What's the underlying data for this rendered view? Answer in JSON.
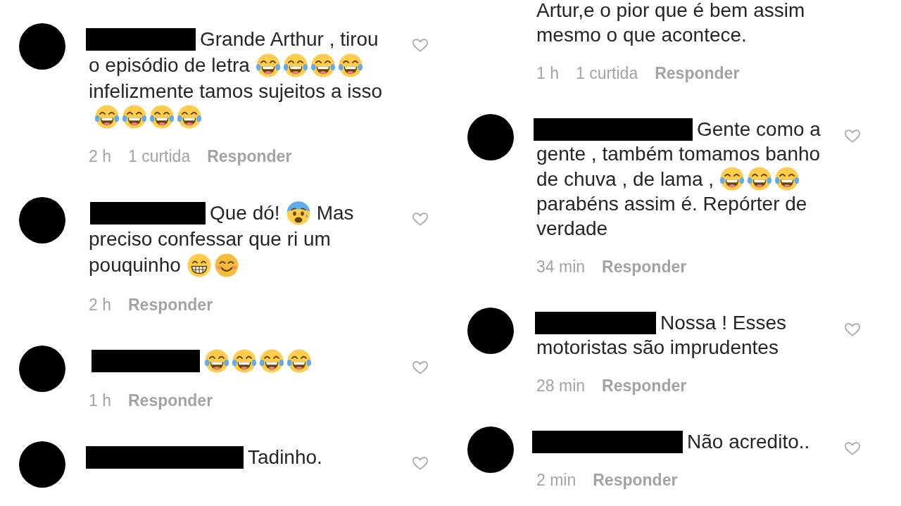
{
  "columns": [
    {
      "comments": [
        {
          "kind": "comment",
          "body": [
            {
              "kind": "text",
              "text": "Grande Arthur , tirou"
            },
            {
              "kind": "text",
              "text": "o episódio de letra"
            },
            {
              "kind": "laughing"
            },
            {
              "kind": "laughing"
            },
            {
              "kind": "laughing"
            },
            {
              "kind": "laughing"
            },
            {
              "kind": "text",
              "text": "infelizmente tamos sujeitos a isso"
            },
            {
              "kind": "laughing"
            },
            {
              "kind": "laughing"
            },
            {
              "kind": "laughing"
            },
            {
              "kind": "laughing"
            }
          ],
          "time": "2 h",
          "likes": "1 curtida",
          "reply": "Responder",
          "liked": false
        },
        {
          "kind": "comment",
          "body": [
            {
              "kind": "text",
              "text": "Que dó!"
            },
            {
              "kind": "anxious"
            },
            {
              "kind": "text",
              "text": "Mas"
            },
            {
              "kind": "text",
              "text": "preciso confessar que ri um"
            },
            {
              "kind": "text",
              "text": "pouquinho"
            },
            {
              "kind": "grinning"
            },
            {
              "kind": "smiling"
            }
          ],
          "time": "2 h",
          "reply": "Responder",
          "liked": false
        },
        {
          "kind": "comment",
          "body": [
            {
              "kind": "laughing"
            },
            {
              "kind": "laughing"
            },
            {
              "kind": "laughing"
            },
            {
              "kind": "laughing"
            }
          ],
          "time": "1 h",
          "reply": "Responder",
          "liked": false
        },
        {
          "kind": "comment",
          "body": [
            {
              "kind": "text",
              "text": "Tadinho."
            }
          ],
          "liked": false
        }
      ]
    },
    {
      "comments": [
        {
          "kind": "continuation",
          "body": [
            {
              "kind": "text",
              "text": "Artur,e o pior que é bem assim"
            },
            {
              "kind": "text",
              "text": "mesmo o que acontece."
            }
          ],
          "time": "1 h",
          "likes": "1 curtida",
          "reply": "Responder"
        },
        {
          "kind": "comment",
          "body": [
            {
              "kind": "text",
              "text": "Gente como a"
            },
            {
              "kind": "text",
              "text": "gente , também tomamos banho"
            },
            {
              "kind": "text",
              "text": "de chuva , de lama ,"
            },
            {
              "kind": "laughing"
            },
            {
              "kind": "laughing"
            },
            {
              "kind": "laughing"
            },
            {
              "kind": "text",
              "text": "parabéns assim é. Repórter de"
            },
            {
              "kind": "text",
              "text": "verdade"
            }
          ],
          "time": "34 min",
          "reply": "Responder",
          "liked": false
        },
        {
          "kind": "comment",
          "body": [
            {
              "kind": "text",
              "text": "Nossa ! Esses"
            },
            {
              "kind": "text",
              "text": "motoristas são imprudentes"
            }
          ],
          "time": "28 min",
          "reply": "Responder",
          "liked": false
        },
        {
          "kind": "comment",
          "body": [
            {
              "kind": "text",
              "text": "Não acredito.."
            }
          ],
          "time": "2 min",
          "reply": "Responder",
          "liked": false
        }
      ]
    }
  ]
}
